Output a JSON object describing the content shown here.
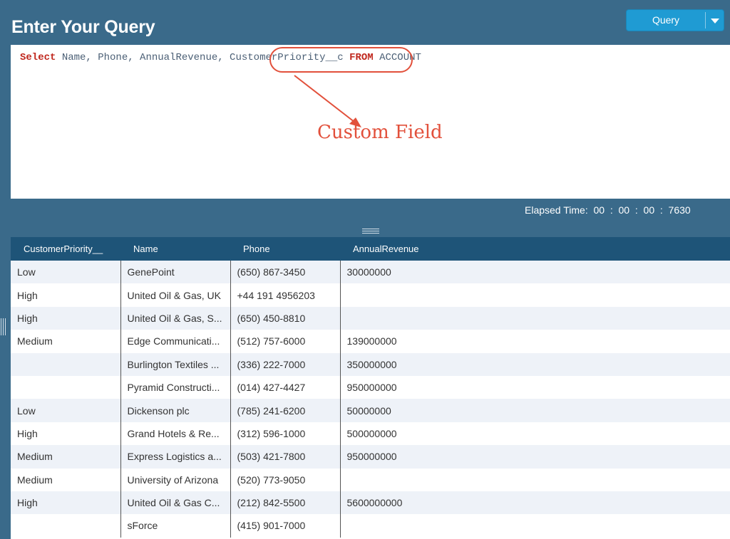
{
  "header": {
    "title": "Enter Your Query",
    "query_button_label": "Query"
  },
  "editor": {
    "code": {
      "kw_select": "Select",
      "fields": " Name, Phone, AnnualRevenue, CustomerPriority__c ",
      "kw_from": "FROM",
      "object": " ACCOUNT"
    }
  },
  "annotation": {
    "label": "Custom Field",
    "color": "#e2503b"
  },
  "status": {
    "elapsed": "Elapsed Time:  00  :  00  :  00  :  7630"
  },
  "results": {
    "columns": [
      "CustomerPriority__",
      "Name",
      "Phone",
      "AnnualRevenue"
    ],
    "rows": [
      [
        "Low",
        "GenePoint",
        "(650) 867-3450",
        "30000000"
      ],
      [
        "High",
        "United Oil & Gas, UK",
        "+44 191 4956203",
        ""
      ],
      [
        "High",
        "United Oil & Gas, S...",
        "(650) 450-8810",
        ""
      ],
      [
        "Medium",
        "Edge Communicati...",
        "(512) 757-6000",
        "139000000"
      ],
      [
        "",
        "Burlington Textiles ...",
        "(336) 222-7000",
        "350000000"
      ],
      [
        "",
        "Pyramid Constructi...",
        "(014) 427-4427",
        "950000000"
      ],
      [
        "Low",
        "Dickenson plc",
        "(785) 241-6200",
        "50000000"
      ],
      [
        "High",
        "Grand Hotels & Re...",
        "(312) 596-1000",
        "500000000"
      ],
      [
        "Medium",
        "Express Logistics a...",
        "(503) 421-7800",
        "950000000"
      ],
      [
        "Medium",
        "University of Arizona",
        "(520) 773-9050",
        ""
      ],
      [
        "High",
        "United Oil & Gas C...",
        "(212) 842-5500",
        "5600000000"
      ],
      [
        "",
        "sForce",
        "(415) 901-7000",
        ""
      ]
    ]
  }
}
